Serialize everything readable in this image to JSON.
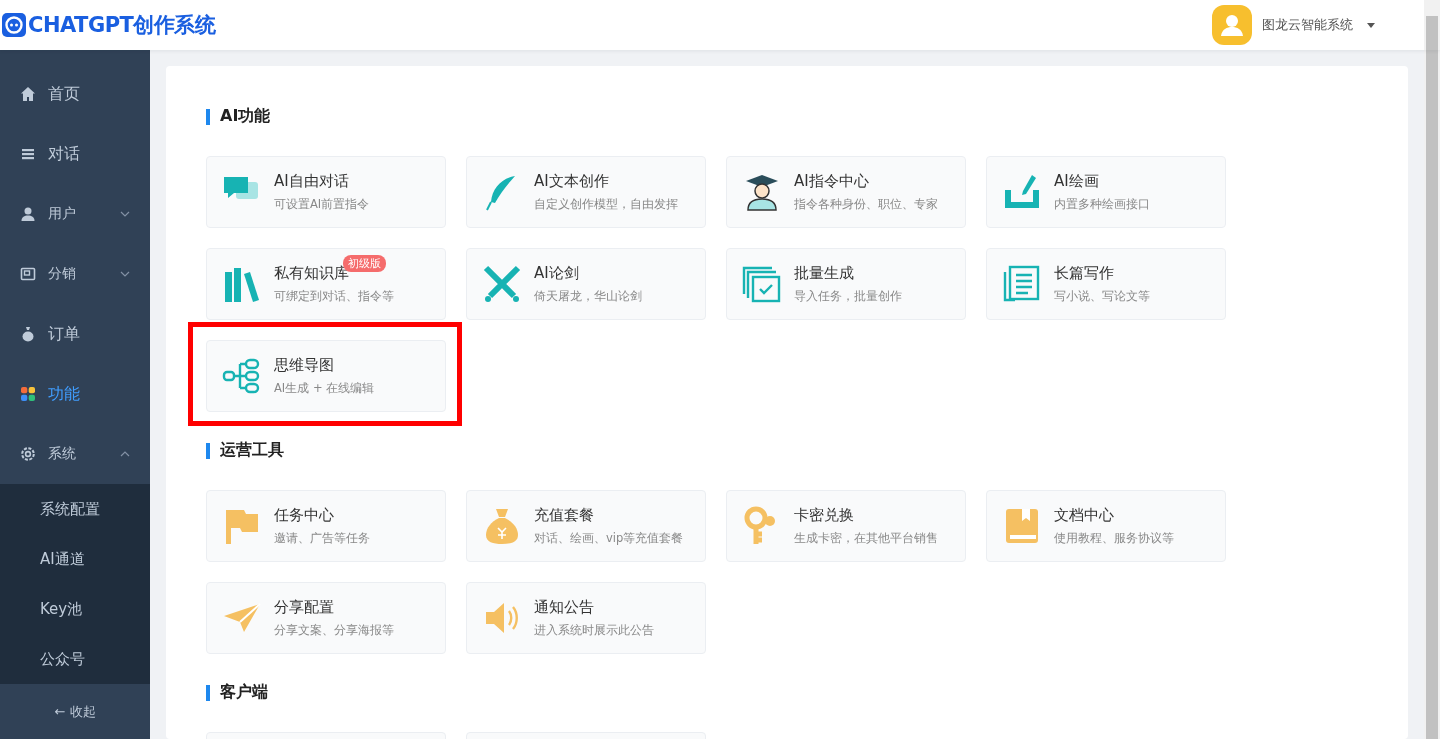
{
  "header": {
    "title": "CHATGPT创作系统",
    "user": "图龙云智能系统"
  },
  "sidebar": {
    "items": [
      {
        "label": "首页",
        "kind": "link",
        "selected": false
      },
      {
        "label": "对话",
        "kind": "link",
        "selected": false
      },
      {
        "label": "用户",
        "kind": "group",
        "selected": false,
        "expanded": false
      },
      {
        "label": "分销",
        "kind": "group",
        "selected": false,
        "expanded": false
      },
      {
        "label": "订单",
        "kind": "link",
        "selected": false
      },
      {
        "label": "功能",
        "kind": "link",
        "selected": true
      },
      {
        "label": "系统",
        "kind": "group",
        "selected": false,
        "expanded": true,
        "children": [
          {
            "label": "系统配置",
            "selected": false
          },
          {
            "label": "AI通道",
            "selected": false
          },
          {
            "label": "Key池",
            "selected": false
          },
          {
            "label": "公众号",
            "selected": false
          }
        ]
      }
    ],
    "collapse": "← 收起"
  },
  "sections": [
    {
      "title": "AI功能",
      "cards": [
        {
          "title": "AI自由对话",
          "desc": "可设置AI前置指令",
          "highlighted": false
        },
        {
          "title": "AI文本创作",
          "desc": "自定义创作模型，自由发挥",
          "highlighted": false
        },
        {
          "title": "AI指令中心",
          "desc": "指令各种身份、职位、专家",
          "highlighted": false
        },
        {
          "title": "AI绘画",
          "desc": "内置多种绘画接口",
          "highlighted": false
        },
        {
          "title": "私有知识库",
          "desc": "可绑定到对话、指令等",
          "badge": "初级版",
          "highlighted": false
        },
        {
          "title": "AI论剑",
          "desc": "倚天屠龙，华山论剑",
          "highlighted": false
        },
        {
          "title": "批量生成",
          "desc": "导入任务，批量创作",
          "highlighted": false
        },
        {
          "title": "长篇写作",
          "desc": "写小说、写论文等",
          "highlighted": false
        },
        {
          "title": "思维导图",
          "desc": "AI生成 + 在线编辑",
          "highlighted": true
        }
      ]
    },
    {
      "title": "运营工具",
      "cards": [
        {
          "title": "任务中心",
          "desc": "邀请、广告等任务",
          "highlighted": false
        },
        {
          "title": "充值套餐",
          "desc": "对话、绘画、vip等充值套餐",
          "highlighted": false
        },
        {
          "title": "卡密兑换",
          "desc": "生成卡密，在其他平台销售",
          "highlighted": false
        },
        {
          "title": "文档中心",
          "desc": "使用教程、服务协议等",
          "highlighted": false
        },
        {
          "title": "分享配置",
          "desc": "分享文案、分享海报等",
          "highlighted": false
        },
        {
          "title": "通知公告",
          "desc": "进入系统时展示此公告",
          "highlighted": false
        }
      ]
    },
    {
      "title": "客户端"
    }
  ]
}
